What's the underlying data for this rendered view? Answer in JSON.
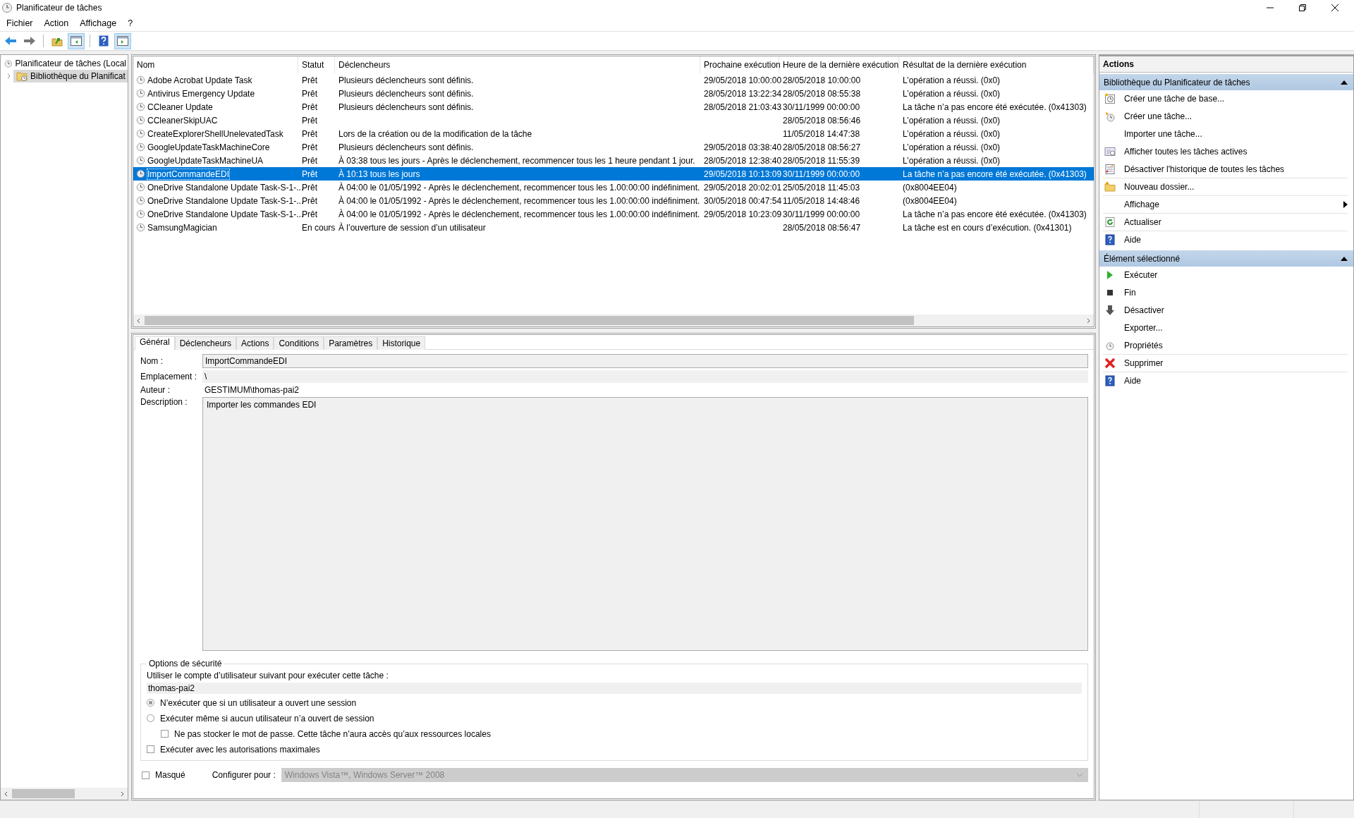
{
  "window": {
    "title": "Planificateur de tâches"
  },
  "menu": [
    "Fichier",
    "Action",
    "Affichage",
    "?"
  ],
  "toolbar_buttons": [
    {
      "on": false
    },
    {
      "on": false
    },
    {
      "on": false
    },
    {
      "on": true
    },
    {
      "on": false
    },
    {
      "on": true
    }
  ],
  "tree": [
    {
      "label": "Planificateur de tâches (Local",
      "selected": false,
      "children": [
        {
          "label": "Bibliothèque du Planificat",
          "selected": true,
          "expanded": false
        }
      ]
    }
  ],
  "table": {
    "columns": [
      "Nom",
      "Statut",
      "Déclencheurs",
      "Prochaine exécution",
      "Heure de la dernière exécution",
      "Résultat de la dernière exécution"
    ],
    "rows": [
      {
        "name": "Adobe Acrobat Update Task",
        "status": "Prêt",
        "triggers": "Plusieurs déclencheurs sont définis.",
        "next_run": "29/05/2018 10:00:00",
        "last_run": "28/05/2018 10:00:00",
        "last_result": "L’opération a réussi. (0x0)",
        "selected": false
      },
      {
        "name": "Antivirus Emergency Update",
        "status": "Prêt",
        "triggers": "Plusieurs déclencheurs sont définis.",
        "next_run": "28/05/2018 13:22:34",
        "last_run": "28/05/2018 08:55:38",
        "last_result": "L’opération a réussi. (0x0)",
        "selected": false
      },
      {
        "name": "CCleaner Update",
        "status": "Prêt",
        "triggers": "Plusieurs déclencheurs sont définis.",
        "next_run": "28/05/2018 21:03:43",
        "last_run": "30/11/1999 00:00:00",
        "last_result": "La tâche n’a pas encore été exécutée. (0x41303)",
        "selected": false
      },
      {
        "name": "CCleanerSkipUAC",
        "status": "Prêt",
        "last_run": "28/05/2018 08:56:46",
        "last_result": "L’opération a réussi. (0x0)",
        "selected": false
      },
      {
        "name": "CreateExplorerShellUnelevatedTask",
        "status": "Prêt",
        "triggers": "Lors de la création ou de la modification de la tâche",
        "last_run": "11/05/2018 14:47:38",
        "last_result": "L’opération a réussi. (0x0)",
        "selected": false
      },
      {
        "name": "GoogleUpdateTaskMachineCore",
        "status": "Prêt",
        "triggers": "Plusieurs déclencheurs sont définis.",
        "next_run": "29/05/2018 03:38:40",
        "last_run": "28/05/2018 08:56:27",
        "last_result": "L’opération a réussi. (0x0)",
        "selected": false
      },
      {
        "name": "GoogleUpdateTaskMachineUA",
        "status": "Prêt",
        "triggers": "À 03:38 tous les jours - Après le déclenchement, recommencer tous les 1 heure pendant 1 jour.",
        "next_run": "28/05/2018 12:38:40",
        "last_run": "28/05/2018 11:55:39",
        "last_result": "L’opération a réussi. (0x0)",
        "selected": false
      },
      {
        "name": "ImportCommandeEDI",
        "status": "Prêt",
        "triggers": "À 10:13 tous les jours",
        "next_run": "29/05/2018 10:13:09",
        "last_run": "30/11/1999 00:00:00",
        "last_result": "La tâche n’a pas encore été exécutée. (0x41303)",
        "selected": true
      },
      {
        "name": "OneDrive Standalone Update Task-S-1-...",
        "status": "Prêt",
        "triggers": "À 04:00 le 01/05/1992 - Après le déclenchement, recommencer tous les 1.00:00:00 indéfiniment.",
        "next_run": "29/05/2018 20:02:01",
        "last_run": "25/05/2018 11:45:03",
        "last_result": "(0x8004EE04)",
        "selected": false
      },
      {
        "name": "OneDrive Standalone Update Task-S-1-...",
        "status": "Prêt",
        "triggers": "À 04:00 le 01/05/1992 - Après le déclenchement, recommencer tous les 1.00:00:00 indéfiniment.",
        "next_run": "30/05/2018 00:47:54",
        "last_run": "11/05/2018 14:48:46",
        "last_result": "(0x8004EE04)",
        "selected": false
      },
      {
        "name": "OneDrive Standalone Update Task-S-1-...",
        "status": "Prêt",
        "triggers": "À 04:00 le 01/05/1992 - Après le déclenchement, recommencer tous les 1.00:00:00 indéfiniment.",
        "next_run": "29/05/2018 10:23:09",
        "last_run": "30/11/1999 00:00:00",
        "last_result": "La tâche n’a pas encore été exécutée. (0x41303)",
        "selected": false
      },
      {
        "name": "SamsungMagician",
        "status": "En cours",
        "triggers": "À l’ouverture de session d’un utilisateur",
        "last_run": "28/05/2018 08:56:47",
        "last_result": "La tâche est en cours d’exécution. (0x41301)",
        "selected": false
      }
    ]
  },
  "details": {
    "tabs": [
      {
        "label": "Général",
        "selected": true
      },
      {
        "label": "Déclencheurs",
        "selected": false
      },
      {
        "label": "Actions",
        "selected": false
      },
      {
        "label": "Conditions",
        "selected": false
      },
      {
        "label": "Paramètres",
        "selected": false
      },
      {
        "label": "Historique",
        "selected": false
      }
    ],
    "name": {
      "label": "Nom :",
      "value": "ImportCommandeEDI"
    },
    "location": {
      "label": "Emplacement :",
      "value": "\\"
    },
    "author": {
      "label": "Auteur :",
      "value": "GESTIMUM\\thomas-pai2"
    },
    "description": {
      "label": "Description :",
      "value": "Importer les commandes EDI"
    },
    "security": {
      "title": "Options de sécurité",
      "account_label": "Utiliser le compte d’utilisateur suivant pour exécuter cette tâche :",
      "account": "thomas-pai2",
      "options": [
        {
          "kind": "radio",
          "label": "N’exécuter que si un utilisateur a ouvert une session",
          "selected": true
        },
        {
          "kind": "radio",
          "label": "Exécuter même si aucun utilisateur n’a ouvert de session",
          "selected": false,
          "children": [
            {
              "kind": "checkbox",
              "label": "Ne pas stocker le mot de passe. Cette tâche n’aura accès qu’aux ressources locales",
              "checked": false
            }
          ]
        },
        {
          "kind": "checkbox",
          "label": "Exécuter avec les autorisations maximales",
          "checked": false
        }
      ]
    },
    "hidden": {
      "label": "Masqué",
      "checked": false
    },
    "configure": {
      "label": "Configurer pour :",
      "value": "Windows Vista™, Windows Server™ 2008",
      "disabled": true
    }
  },
  "actions": {
    "title": "Actions",
    "sections": [
      {
        "title": "Bibliothèque du Planificateur de tâches",
        "expanded": true,
        "items": [
          {
            "label": "Créer une tâche de base..."
          },
          {
            "label": "Créer une tâche..."
          },
          {
            "label": "Importer une tâche..."
          },
          {
            "label": "Afficher toutes les tâches actives"
          },
          {
            "label": "Désactiver l'historique de toutes les tâches"
          },
          {
            "label": "Nouveau dossier..."
          },
          {
            "label": "Affichage",
            "submenu": true
          },
          {
            "label": "Actualiser"
          },
          {
            "label": "Aide"
          }
        ]
      },
      {
        "title": "Élément sélectionné",
        "expanded": true,
        "items": [
          {
            "label": "Exécuter"
          },
          {
            "label": "Fin"
          },
          {
            "label": "Désactiver"
          },
          {
            "label": "Exporter..."
          },
          {
            "label": "Propriétés"
          },
          {
            "label": "Supprimer"
          },
          {
            "label": "Aide"
          }
        ]
      }
    ]
  }
}
